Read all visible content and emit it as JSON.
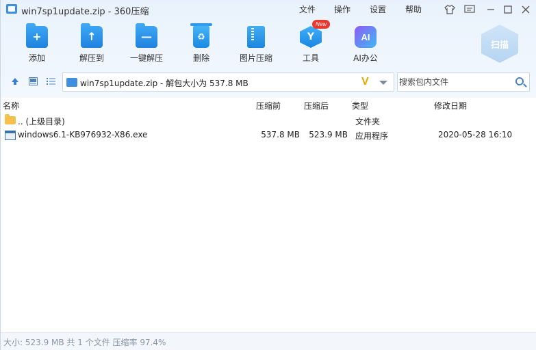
{
  "window": {
    "title": "win7sp1update.zip - 360压缩",
    "menu": [
      "文件",
      "操作",
      "设置",
      "帮助"
    ]
  },
  "toolbar": {
    "items": [
      {
        "label": "添加",
        "icon": "folder-add-icon"
      },
      {
        "label": "解压到",
        "icon": "folder-extract-icon"
      },
      {
        "label": "一键解压",
        "icon": "folder-quick-extract-icon"
      },
      {
        "label": "删除",
        "icon": "recycle-bin-icon"
      },
      {
        "label": "图片压缩",
        "icon": "image-compress-icon"
      },
      {
        "label": "工具",
        "icon": "tools-icon",
        "badge": "New"
      },
      {
        "label": "AI办公",
        "icon": "ai-icon",
        "icon_text": "AI"
      }
    ],
    "scan_label": "扫描"
  },
  "address": {
    "text": "win7sp1update.zip - 解包大小为 537.8 MB",
    "logo_text": "V"
  },
  "search": {
    "placeholder": "搜索包内文件"
  },
  "columns": {
    "name": "名称",
    "compressed_before": "压缩前",
    "compressed_after": "压缩后",
    "type": "类型",
    "modified": "修改日期"
  },
  "rows": [
    {
      "name": ".. (上级目录)",
      "before": "",
      "after": "",
      "type": "文件夹",
      "modified": ""
    },
    {
      "name": "windows6.1-KB976932-X86.exe",
      "before": "537.8 MB",
      "after": "523.9 MB",
      "type": "应用程序",
      "modified": "2020-05-28 16:10"
    }
  ],
  "status": {
    "text": "大小: 523.9 MB 共 1 个文件 压缩率 97.4%"
  },
  "colors": {
    "accent": "#1f82df",
    "badge": "#e8372c",
    "address_logo": "#f0a800"
  }
}
